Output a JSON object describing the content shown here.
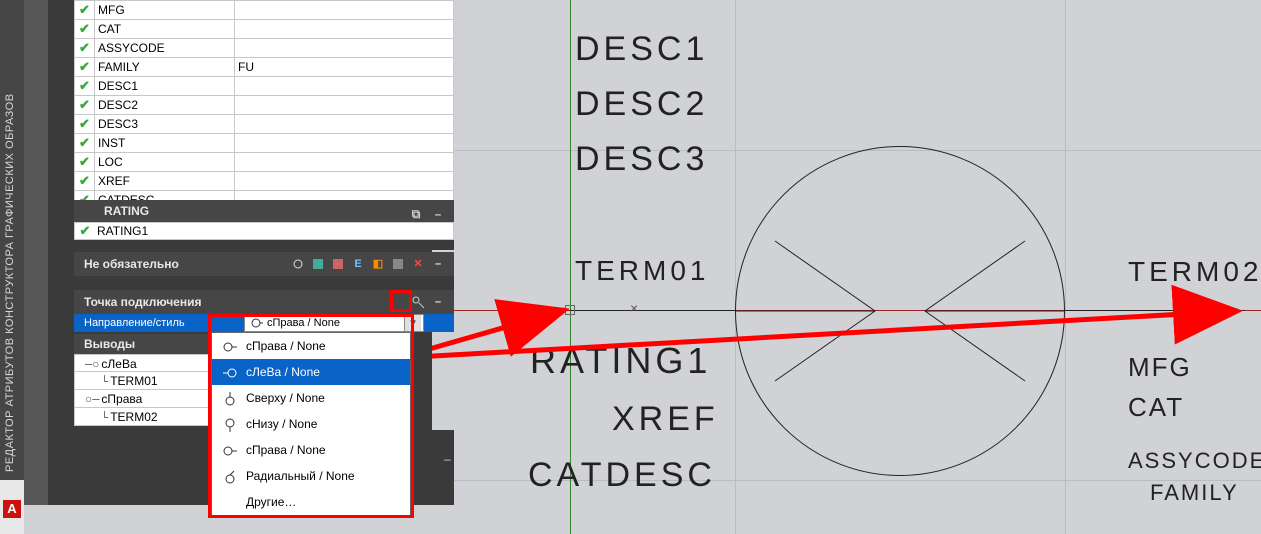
{
  "sidebar": {
    "title": "РЕДАКТОР АТРИБУТОВ КОНСТРУКТОРА ГРАФИЧЕСКИХ ОБРАЗОВ",
    "logo": "A"
  },
  "attrs": {
    "rows": [
      {
        "name": "MFG",
        "val": ""
      },
      {
        "name": "CAT",
        "val": ""
      },
      {
        "name": "ASSYCODE",
        "val": ""
      },
      {
        "name": "FAMILY",
        "val": "FU"
      },
      {
        "name": "DESC1",
        "val": ""
      },
      {
        "name": "DESC2",
        "val": ""
      },
      {
        "name": "DESC3",
        "val": ""
      },
      {
        "name": "INST",
        "val": ""
      },
      {
        "name": "LOC",
        "val": ""
      },
      {
        "name": "XREF",
        "val": ""
      },
      {
        "name": "CATDESC",
        "val": ""
      }
    ]
  },
  "rating": {
    "hdr": "RATING",
    "row": "RATING1",
    "collapse": "–"
  },
  "optional": {
    "hdr": "Не обязательно",
    "collapse": "–"
  },
  "connpt": {
    "hdr": "Точка подключения",
    "collapse": "–",
    "dir_label": "Направление/стиль",
    "dir_value": "сПрава / None"
  },
  "outputs": {
    "hdr": "Выводы",
    "collapse": "–",
    "items": [
      {
        "icon": "left",
        "name": "сЛеВа"
      },
      {
        "icon": "child",
        "name": "TERM01"
      },
      {
        "icon": "right",
        "name": "сПрава"
      },
      {
        "icon": "child",
        "name": "TERM02"
      }
    ]
  },
  "dropdown": {
    "items": [
      {
        "label": "сПрава / None"
      },
      {
        "label": "сЛеВа / None"
      },
      {
        "label": "Сверху / None"
      },
      {
        "label": "сНизу / None"
      },
      {
        "label": "сПрава / None"
      },
      {
        "label": "Радиальный / None"
      },
      {
        "label": "Другие…"
      }
    ],
    "selected_index": 1
  },
  "canvas": {
    "labels": {
      "desc1": "DESC1",
      "desc2": "DESC2",
      "desc3": "DESC3",
      "term01": "TERM01",
      "term02": "TERM02",
      "rating1": "RATING1",
      "xref": "XREF",
      "catdesc": "CATDESC",
      "mfg": "MFG",
      "cat": "CAT",
      "assycode": "ASSYCODE",
      "family": "FAMILY"
    }
  }
}
